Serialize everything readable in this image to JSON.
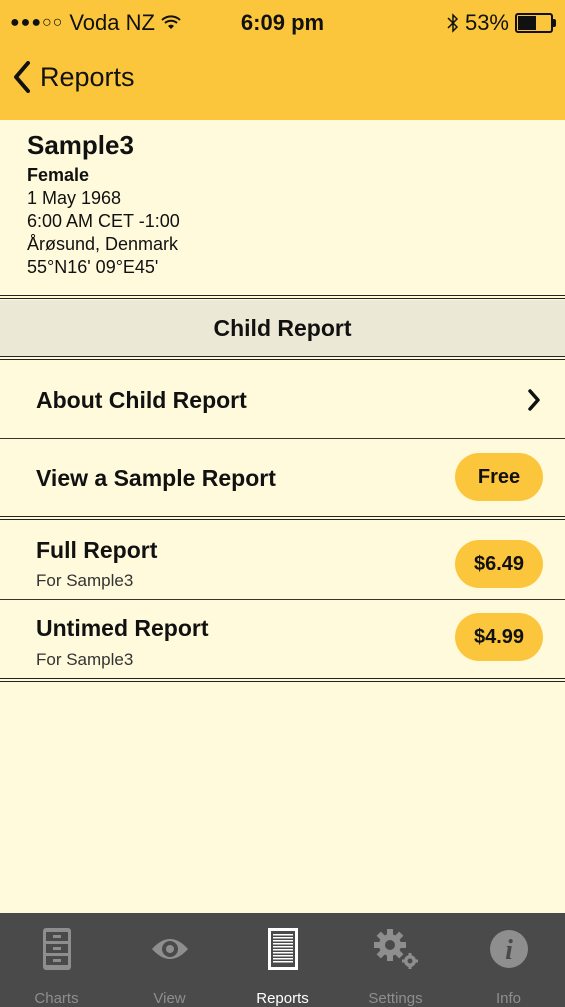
{
  "status_bar": {
    "carrier": "Voda NZ",
    "time": "6:09 pm",
    "battery": "53%",
    "signal_icon": "signal-dots-icon",
    "wifi_icon": "wifi-icon",
    "bluetooth_icon": "bluetooth-icon",
    "battery_level": 0.53
  },
  "nav": {
    "back_label": "Reports"
  },
  "profile": {
    "name": "Sample3",
    "gender": "Female",
    "date": "1 May 1968",
    "time": "6:00 AM CET -1:00",
    "place": "Årøsund, Denmark",
    "coords": "55°N16' 09°E45'"
  },
  "section": {
    "title": "Child Report"
  },
  "rows": {
    "about": "About Child Report",
    "sample": "View a Sample Report",
    "sample_price": "Free",
    "full_title": "Full Report",
    "full_sub": "For Sample3",
    "full_price": "$6.49",
    "untimed_title": "Untimed Report",
    "untimed_sub": "For Sample3",
    "untimed_price": "$4.99"
  },
  "tabs": {
    "charts": "Charts",
    "view": "View",
    "reports": "Reports",
    "settings": "Settings",
    "info": "Info",
    "active": "Reports"
  },
  "colors": {
    "accent": "#fcc63c",
    "background": "#fffadc",
    "tabbar": "#4a4a4a"
  }
}
